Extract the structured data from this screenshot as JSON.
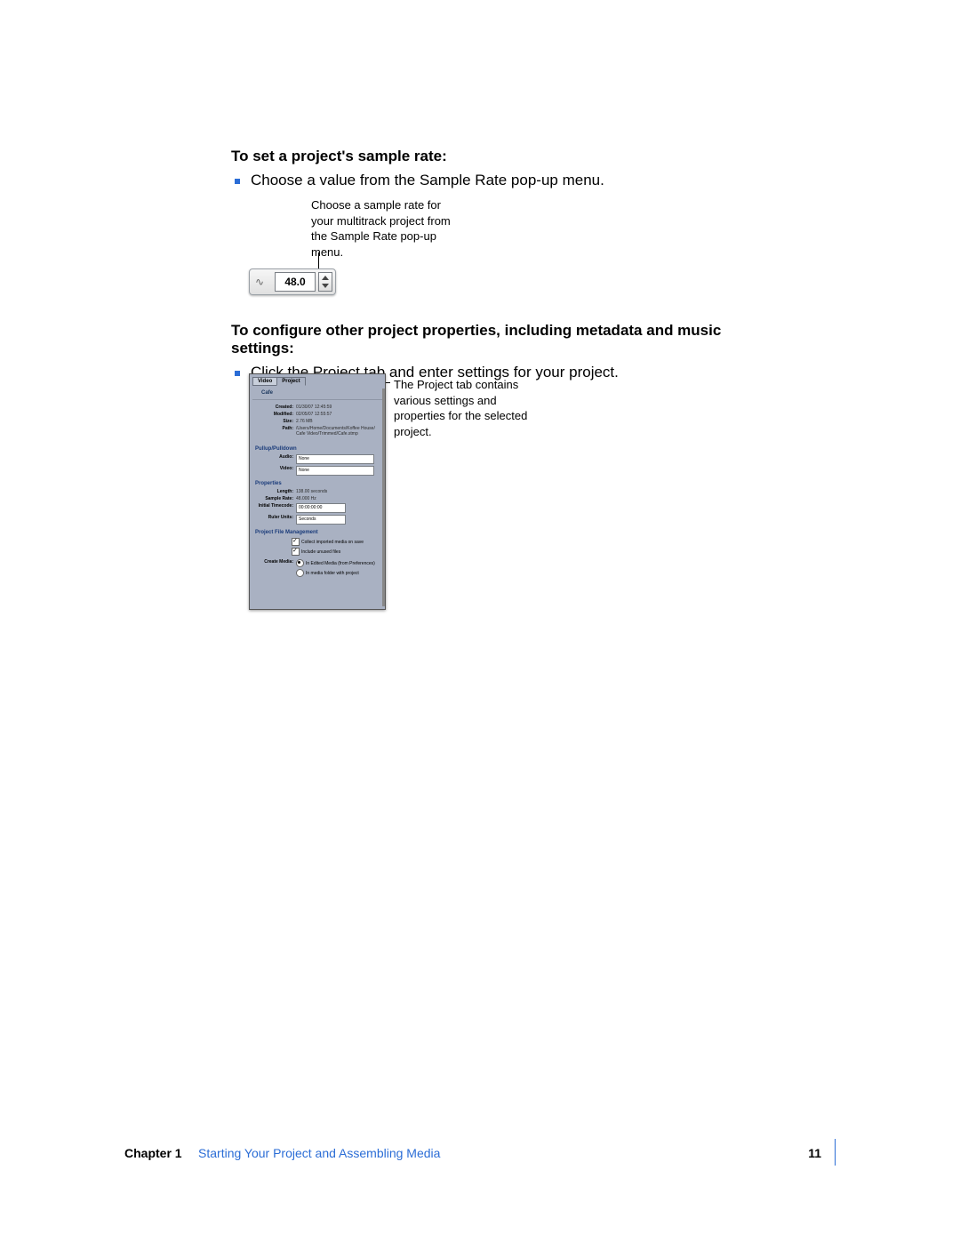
{
  "heading1": "To set a project's sample rate:",
  "bullet1": "Choose a value from the Sample Rate pop-up menu.",
  "callout1": "Choose a sample rate for your multitrack project from the Sample Rate pop-up menu.",
  "sample_rate_widget": {
    "value": "48.0"
  },
  "heading2": "To configure other project properties, including metadata and music settings:",
  "bullet2": "Click the Project tab and enter settings for your project.",
  "callout2": "The Project tab contains various settings and properties for the selected project.",
  "panel": {
    "tabs": {
      "video": "Video",
      "project": "Project"
    },
    "project_name": "Cafe",
    "info": {
      "created_label": "Created:",
      "created": "01/30/07  12:45:59",
      "modified_label": "Modified:",
      "modified": "02/05/07  12:55:57",
      "size_label": "Size:",
      "size": "2.76 MB",
      "path_label": "Path:",
      "path": "/Users/Home/Documents/Koffee House/Cafe Video/Trimmed/Cafe.stmp"
    },
    "pullup": {
      "section": "Pullup/Pulldown",
      "audio_label": "Audio:",
      "audio": "None",
      "video_label": "Video:",
      "video": "None"
    },
    "properties": {
      "section": "Properties",
      "length_label": "Length:",
      "length": "138.00 seconds",
      "sr_label": "Sample Rate:",
      "sr": "48.000 Hz",
      "tc_label": "Initial Timecode:",
      "tc": "00:00:00:00",
      "ruler_label": "Ruler Units:",
      "ruler": "Seconds"
    },
    "pfm": {
      "section": "Project File Management",
      "collect": "Collect imported media on save",
      "include": "Include unused files",
      "create_label": "Create Media:",
      "opt1": "In Edited Media (from Preferences)",
      "opt2": "In media folder with project"
    }
  },
  "footer": {
    "chapter": "Chapter 1",
    "title": "Starting Your Project and Assembling Media",
    "page": "11"
  }
}
